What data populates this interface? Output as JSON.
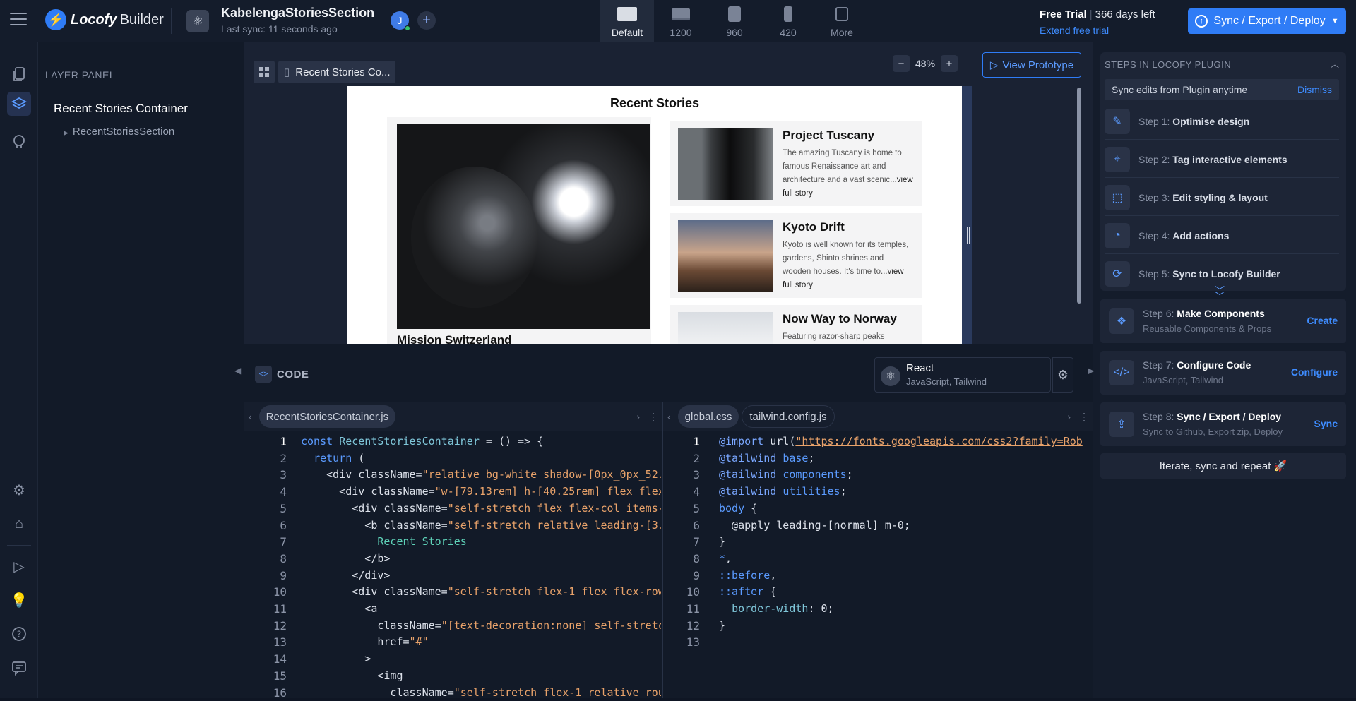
{
  "app": {
    "logo_name": "Locofy",
    "logo_suffix": "Builder"
  },
  "project": {
    "title": "KabelengaStoriesSection",
    "last_sync": "Last sync: 11 seconds ago",
    "avatar_initial": "J"
  },
  "devices": [
    {
      "label": "Default",
      "icon": "desktop-icon",
      "active": true
    },
    {
      "label": "1200",
      "icon": "laptop-icon"
    },
    {
      "label": "960",
      "icon": "tablet-icon"
    },
    {
      "label": "420",
      "icon": "phone-icon"
    },
    {
      "label": "More",
      "icon": "more-devices-icon"
    }
  ],
  "trial": {
    "label": "Free Trial",
    "days": "366 days left",
    "extend": "Extend free trial"
  },
  "header_sync": {
    "label": "Sync / Export / Deploy"
  },
  "layer_panel": {
    "title": "LAYER PANEL",
    "root": "Recent Stories Container",
    "child": "RecentStoriesSection"
  },
  "canvas": {
    "tab_label": "Recent Stories Co...",
    "zoom": "48%",
    "view_prototype": "View Prototype",
    "preview": {
      "heading": "Recent Stories",
      "featured_caption": "Mission Switzerland",
      "stories": [
        {
          "title": "Project Tuscany",
          "text": "The amazing Tuscany is home to famous Renaissance art and architecture and a vast scenic...",
          "link": "view full story"
        },
        {
          "title": "Kyoto Drift",
          "text": "Kyoto is well known for its temples, gardens, Shinto shrines and wooden houses. It's time to...",
          "link": "view full story"
        },
        {
          "title": "Now Way to Norway",
          "text": "Featuring razor-sharp peaks",
          "link": ""
        }
      ]
    }
  },
  "code_panel": {
    "title": "CODE",
    "framework": {
      "name": "React",
      "sub": "JavaScript, Tailwind"
    },
    "left_tabs": [
      "RecentStoriesContainer.js"
    ],
    "right_tabs": [
      "global.css",
      "tailwind.config.js"
    ],
    "left_line_count": 16,
    "right_line_count": 13
  },
  "steps_panel": {
    "title": "STEPS IN LOCOFY PLUGIN",
    "sync_edits": "Sync edits from Plugin anytime",
    "dismiss": "Dismiss",
    "steps": [
      {
        "num": "Step 1:",
        "name": "Optimise design",
        "icon": "optimise-icon"
      },
      {
        "num": "Step 2:",
        "name": "Tag interactive elements",
        "icon": "tag-icon"
      },
      {
        "num": "Step 3:",
        "name": "Edit styling & layout",
        "icon": "styling-icon"
      },
      {
        "num": "Step 4:",
        "name": "Add actions",
        "icon": "actions-icon"
      },
      {
        "num": "Step 5:",
        "name": "Sync to Locofy Builder",
        "icon": "sync-icon"
      }
    ],
    "cards": [
      {
        "num": "Step 6:",
        "name": "Make Components",
        "sub": "Reusable Components & Props",
        "action": "Create",
        "icon": "components-icon"
      },
      {
        "num": "Step 7:",
        "name": "Configure Code",
        "sub": "JavaScript, Tailwind",
        "action": "Configure",
        "icon": "configure-icon"
      },
      {
        "num": "Step 8:",
        "name": "Sync / Export / Deploy",
        "sub": "Sync to Github, Export zip, Deploy",
        "action": "Sync",
        "icon": "export-icon"
      }
    ],
    "iterate": "Iterate, sync and repeat 🚀"
  },
  "colors": {
    "accent": "#2f7cf6",
    "background": "#0f1624",
    "panel": "#141c2b"
  }
}
